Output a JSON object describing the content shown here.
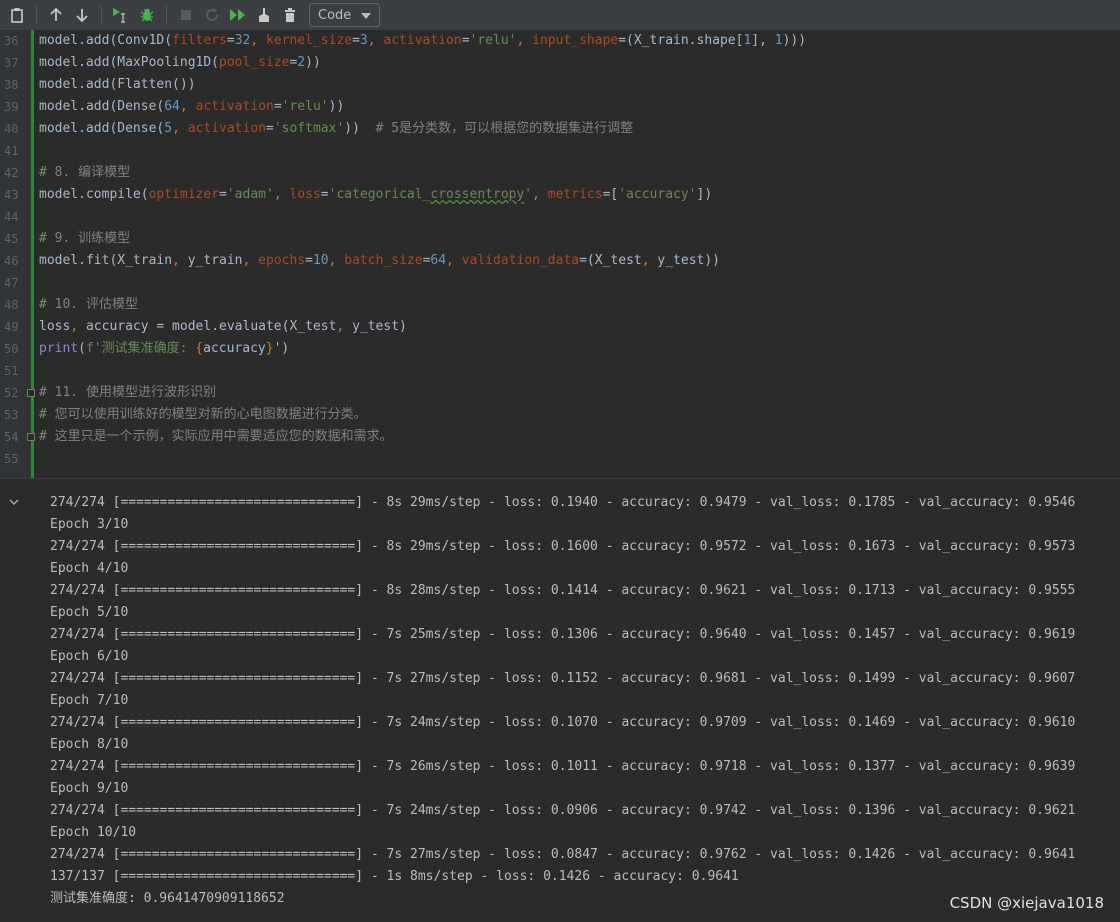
{
  "toolbar": {
    "cell_type": "Code",
    "icons": [
      "clipboard-icon",
      "arrow-up-icon",
      "arrow-down-icon",
      "run-cursor-icon",
      "debug-icon",
      "stop-icon",
      "restart-icon",
      "run-all-icon",
      "clear-icon",
      "delete-icon"
    ]
  },
  "editor": {
    "lines": [
      {
        "num": "36",
        "segments": [
          [
            "model.add(Conv1D(",
            ""
          ],
          [
            "filters",
            "param"
          ],
          [
            "=",
            ""
          ],
          [
            "32",
            "num"
          ],
          [
            ", ",
            "br"
          ],
          [
            "kernel_size",
            "param"
          ],
          [
            "=",
            ""
          ],
          [
            "3",
            "num"
          ],
          [
            ", ",
            "br"
          ],
          [
            "activation",
            "param"
          ],
          [
            "=",
            ""
          ],
          [
            "'relu'",
            "str"
          ],
          [
            ", ",
            "br"
          ],
          [
            "input_shape",
            "param"
          ],
          [
            "=(X_train.shape[",
            ""
          ],
          [
            "1",
            "num"
          ],
          [
            "], ",
            ""
          ],
          [
            "1",
            "num"
          ],
          [
            ")))",
            ""
          ]
        ]
      },
      {
        "num": "37",
        "segments": [
          [
            "model.add(MaxPooling1D(",
            ""
          ],
          [
            "pool_size",
            "param"
          ],
          [
            "=",
            ""
          ],
          [
            "2",
            "num"
          ],
          [
            "))",
            ""
          ]
        ]
      },
      {
        "num": "38",
        "segments": [
          [
            "model.add(Flatten())",
            ""
          ]
        ]
      },
      {
        "num": "39",
        "segments": [
          [
            "model.add(Dense(",
            ""
          ],
          [
            "64",
            "num"
          ],
          [
            ", ",
            "br"
          ],
          [
            "activation",
            "param"
          ],
          [
            "=",
            ""
          ],
          [
            "'relu'",
            "str"
          ],
          [
            "))",
            ""
          ]
        ]
      },
      {
        "num": "40",
        "segments": [
          [
            "model.add(Dense(",
            ""
          ],
          [
            "5",
            "num"
          ],
          [
            ", ",
            "br"
          ],
          [
            "activation",
            "param"
          ],
          [
            "=",
            ""
          ],
          [
            "'softmax'",
            "str"
          ],
          [
            "))  ",
            ""
          ],
          [
            "# 5是分类数，可以根据您的数据集进行调整",
            "cm"
          ]
        ]
      },
      {
        "num": "41",
        "segments": []
      },
      {
        "num": "42",
        "segments": [
          [
            "# 8. 编译模型",
            "cm"
          ]
        ]
      },
      {
        "num": "43",
        "segments": [
          [
            "model.compile(",
            ""
          ],
          [
            "optimizer",
            "param"
          ],
          [
            "=",
            ""
          ],
          [
            "'adam'",
            "str"
          ],
          [
            ", ",
            "br"
          ],
          [
            "loss",
            "param"
          ],
          [
            "=",
            ""
          ],
          [
            "'categorical_",
            "str"
          ],
          [
            "crossentropy",
            "strwavy"
          ],
          [
            "'",
            "str"
          ],
          [
            ", ",
            "br"
          ],
          [
            "metrics",
            "param"
          ],
          [
            "=[",
            ""
          ],
          [
            "'accuracy'",
            "str"
          ],
          [
            "])",
            ""
          ]
        ]
      },
      {
        "num": "44",
        "segments": []
      },
      {
        "num": "45",
        "segments": [
          [
            "# 9. 训练模型",
            "cm"
          ]
        ]
      },
      {
        "num": "46",
        "segments": [
          [
            "model.fit(X_train",
            ""
          ],
          [
            ", ",
            "br"
          ],
          [
            "y_train",
            ""
          ],
          [
            ", ",
            "br"
          ],
          [
            "epochs",
            "param"
          ],
          [
            "=",
            ""
          ],
          [
            "10",
            "num"
          ],
          [
            ", ",
            "br"
          ],
          [
            "batch_size",
            "param"
          ],
          [
            "=",
            ""
          ],
          [
            "64",
            "num"
          ],
          [
            ", ",
            "br"
          ],
          [
            "validation_data",
            "param"
          ],
          [
            "=(X_test",
            ""
          ],
          [
            ", ",
            "br"
          ],
          [
            "y_test))",
            ""
          ]
        ]
      },
      {
        "num": "47",
        "segments": []
      },
      {
        "num": "48",
        "segments": [
          [
            "# 10. 评估模型",
            "cm"
          ]
        ]
      },
      {
        "num": "49",
        "segments": [
          [
            "loss",
            ""
          ],
          [
            ", ",
            "br"
          ],
          [
            "accuracy = model.evaluate(X_test",
            ""
          ],
          [
            ", ",
            "br"
          ],
          [
            "y_test)",
            ""
          ]
        ]
      },
      {
        "num": "50",
        "segments": [
          [
            "print",
            "fn"
          ],
          [
            "(",
            ""
          ],
          [
            "f'测试集准确度: ",
            "str"
          ],
          [
            "{",
            "br"
          ],
          [
            "accuracy",
            ""
          ],
          [
            "}",
            "br"
          ],
          [
            "')",
            ""
          ]
        ]
      },
      {
        "num": "51",
        "segments": []
      },
      {
        "num": "52",
        "segments": [
          [
            "# 11. 使用模型进行波形识别",
            "cm"
          ]
        ],
        "fold": true
      },
      {
        "num": "53",
        "segments": [
          [
            "# 您可以使用训练好的模型对新的心电图数据进行分类。",
            "cm"
          ]
        ]
      },
      {
        "num": "54",
        "segments": [
          [
            "# 这里只是一个示例，实际应用中需要适应您的数据和需求。",
            "cm"
          ]
        ],
        "fold": true
      },
      {
        "num": "55",
        "segments": []
      }
    ]
  },
  "output": {
    "lines": [
      "274/274 [==============================] - 8s 29ms/step - loss: 0.1940 - accuracy: 0.9479 - val_loss: 0.1785 - val_accuracy: 0.9546",
      "Epoch 3/10",
      "274/274 [==============================] - 8s 29ms/step - loss: 0.1600 - accuracy: 0.9572 - val_loss: 0.1673 - val_accuracy: 0.9573",
      "Epoch 4/10",
      "274/274 [==============================] - 8s 28ms/step - loss: 0.1414 - accuracy: 0.9621 - val_loss: 0.1713 - val_accuracy: 0.9555",
      "Epoch 5/10",
      "274/274 [==============================] - 7s 25ms/step - loss: 0.1306 - accuracy: 0.9640 - val_loss: 0.1457 - val_accuracy: 0.9619",
      "Epoch 6/10",
      "274/274 [==============================] - 7s 27ms/step - loss: 0.1152 - accuracy: 0.9681 - val_loss: 0.1499 - val_accuracy: 0.9607",
      "Epoch 7/10",
      "274/274 [==============================] - 7s 24ms/step - loss: 0.1070 - accuracy: 0.9709 - val_loss: 0.1469 - val_accuracy: 0.9610",
      "Epoch 8/10",
      "274/274 [==============================] - 7s 26ms/step - loss: 0.1011 - accuracy: 0.9718 - val_loss: 0.1377 - val_accuracy: 0.9639",
      "Epoch 9/10",
      "274/274 [==============================] - 7s 24ms/step - loss: 0.0906 - accuracy: 0.9742 - val_loss: 0.1396 - val_accuracy: 0.9621",
      "Epoch 10/10",
      "274/274 [==============================] - 7s 27ms/step - loss: 0.0847 - accuracy: 0.9762 - val_loss: 0.1426 - val_accuracy: 0.9641",
      "137/137 [==============================] - 1s 8ms/step - loss: 0.1426 - accuracy: 0.9641",
      "测试集准确度: 0.9641470909118652"
    ]
  },
  "watermark": "CSDN @xiejava1018"
}
